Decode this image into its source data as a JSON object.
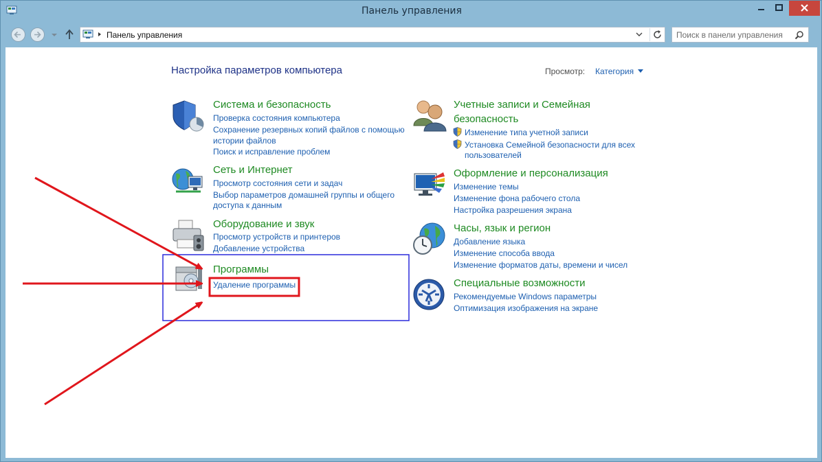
{
  "window": {
    "title": "Панель управления"
  },
  "toolbar": {
    "address_path": "Панель управления",
    "search_placeholder": "Поиск в панели управления"
  },
  "main": {
    "heading": "Настройка параметров компьютера",
    "view_label": "Просмотр:",
    "view_value": "Категория"
  },
  "categories": {
    "system": {
      "title": "Система и безопасность",
      "links": [
        "Проверка состояния компьютера",
        "Сохранение резервных копий файлов с помощью",
        "истории файлов",
        "Поиск и исправление проблем"
      ]
    },
    "network": {
      "title": "Сеть и Интернет",
      "links": [
        "Просмотр состояния сети и задач",
        "Выбор параметров домашней группы и общего",
        "доступа к данным"
      ]
    },
    "hardware": {
      "title": "Оборудование и звук",
      "links": [
        "Просмотр устройств и принтеров",
        "Добавление устройства"
      ]
    },
    "programs": {
      "title": "Программы",
      "links": [
        "Удаление программы"
      ]
    },
    "accounts": {
      "title_line1": "Учетные записи и Семейная",
      "title_line2": "безопасность",
      "links": [
        "Изменение типа учетной записи",
        "Установка Семейной безопасности для всех",
        "пользователей"
      ]
    },
    "appearance": {
      "title": "Оформление и персонализация",
      "links": [
        "Изменение темы",
        "Изменение фона рабочего стола",
        "Настройка разрешения экрана"
      ]
    },
    "clock": {
      "title": "Часы, язык и регион",
      "links": [
        "Добавление языка",
        "Изменение способа ввода",
        "Изменение форматов даты, времени и чисел"
      ]
    },
    "access": {
      "title": "Специальные возможности",
      "links": [
        "Рекомендуемые Windows параметры",
        "Оптимизация изображения на экране"
      ]
    }
  },
  "colors": {
    "category_title": "#1e8a22",
    "link": "#1d5fb0",
    "heading": "#1e3287",
    "annotation_red": "#e0161c",
    "annotation_blue": "#2a2adb"
  }
}
